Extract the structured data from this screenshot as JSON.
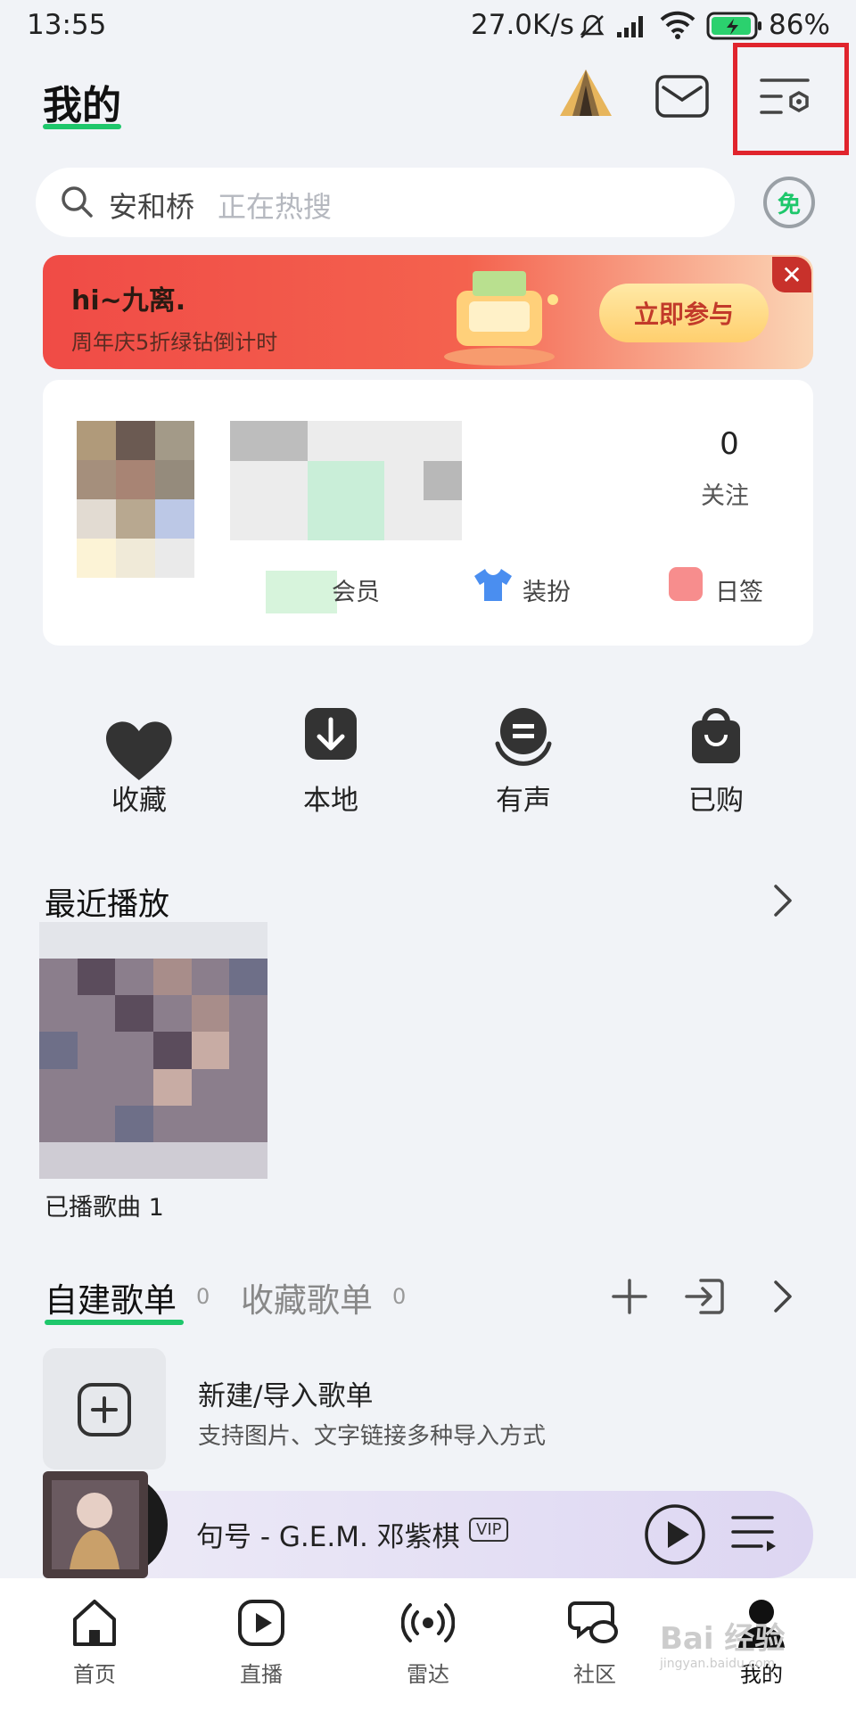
{
  "status_bar": {
    "time": "13:55",
    "speed": "27.0K/s",
    "battery": "86%"
  },
  "header": {
    "title": "我的"
  },
  "search": {
    "keyword": "安和桥",
    "hint": "正在热搜",
    "free_badge": "免"
  },
  "banner": {
    "greeting": "hi~九离.",
    "subtitle": "周年庆5折绿钻倒计时",
    "button": "立即参与",
    "close": "✕"
  },
  "profile": {
    "follow_count": "0",
    "follow_label": "关注",
    "vip_label": "会员",
    "dress_label": "装扮",
    "sign_label": "日签"
  },
  "quick": [
    {
      "label": "收藏",
      "icon": "heart-icon"
    },
    {
      "label": "本地",
      "icon": "download-icon"
    },
    {
      "label": "有声",
      "icon": "audiobook-icon"
    },
    {
      "label": "已购",
      "icon": "bag-icon"
    }
  ],
  "recent": {
    "title": "最近播放",
    "item_label": "已播歌曲 1"
  },
  "playlists": {
    "tab_created": "自建歌单",
    "created_count": "0",
    "tab_collected": "收藏歌单",
    "collected_count": "0",
    "new_title": "新建/导入歌单",
    "new_subtitle": "支持图片、文字链接多种导入方式"
  },
  "player": {
    "song": "句号 - G.E.M. 邓紫棋",
    "vip": "VIP"
  },
  "nav": [
    {
      "label": "首页",
      "icon": "home-icon"
    },
    {
      "label": "直播",
      "icon": "live-icon"
    },
    {
      "label": "雷达",
      "icon": "radar-icon"
    },
    {
      "label": "社区",
      "icon": "community-icon"
    },
    {
      "label": "我的",
      "icon": "profile-icon"
    }
  ],
  "watermark": {
    "text": "Bai 经验",
    "url": "jingyan.baidu.com"
  },
  "colors": {
    "accent": "#1ec76b",
    "highlight": "#e0242d",
    "banner": "#f04b46"
  }
}
